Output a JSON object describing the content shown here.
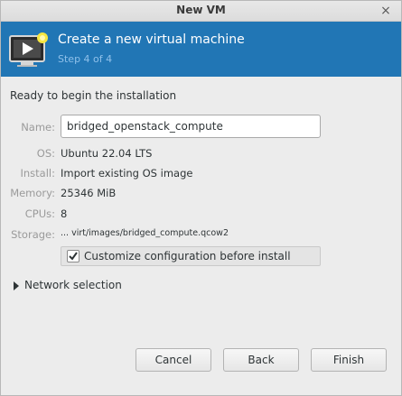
{
  "window": {
    "title": "New VM",
    "close_glyph": "×"
  },
  "banner": {
    "title": "Create a new virtual machine",
    "step": "Step 4 of 4",
    "icon": "vm-monitor-icon",
    "color": "#2176b5"
  },
  "summary": {
    "heading": "Ready to begin the installation",
    "name_label": "Name:",
    "name_value": "bridged_openstack_compute",
    "os_label": "OS:",
    "os_value": "Ubuntu 22.04 LTS",
    "install_label": "Install:",
    "install_value": "Import existing OS image",
    "memory_label": "Memory:",
    "memory_value": "25346 MiB",
    "cpus_label": "CPUs:",
    "cpus_value": "8",
    "storage_label": "Storage:",
    "storage_value": "... virt/images/bridged_compute.qcow2"
  },
  "customize": {
    "label": "Customize configuration before install",
    "checked": true
  },
  "network": {
    "label": "Network selection",
    "expanded": false
  },
  "buttons": {
    "cancel": "Cancel",
    "back": "Back",
    "finish": "Finish"
  }
}
